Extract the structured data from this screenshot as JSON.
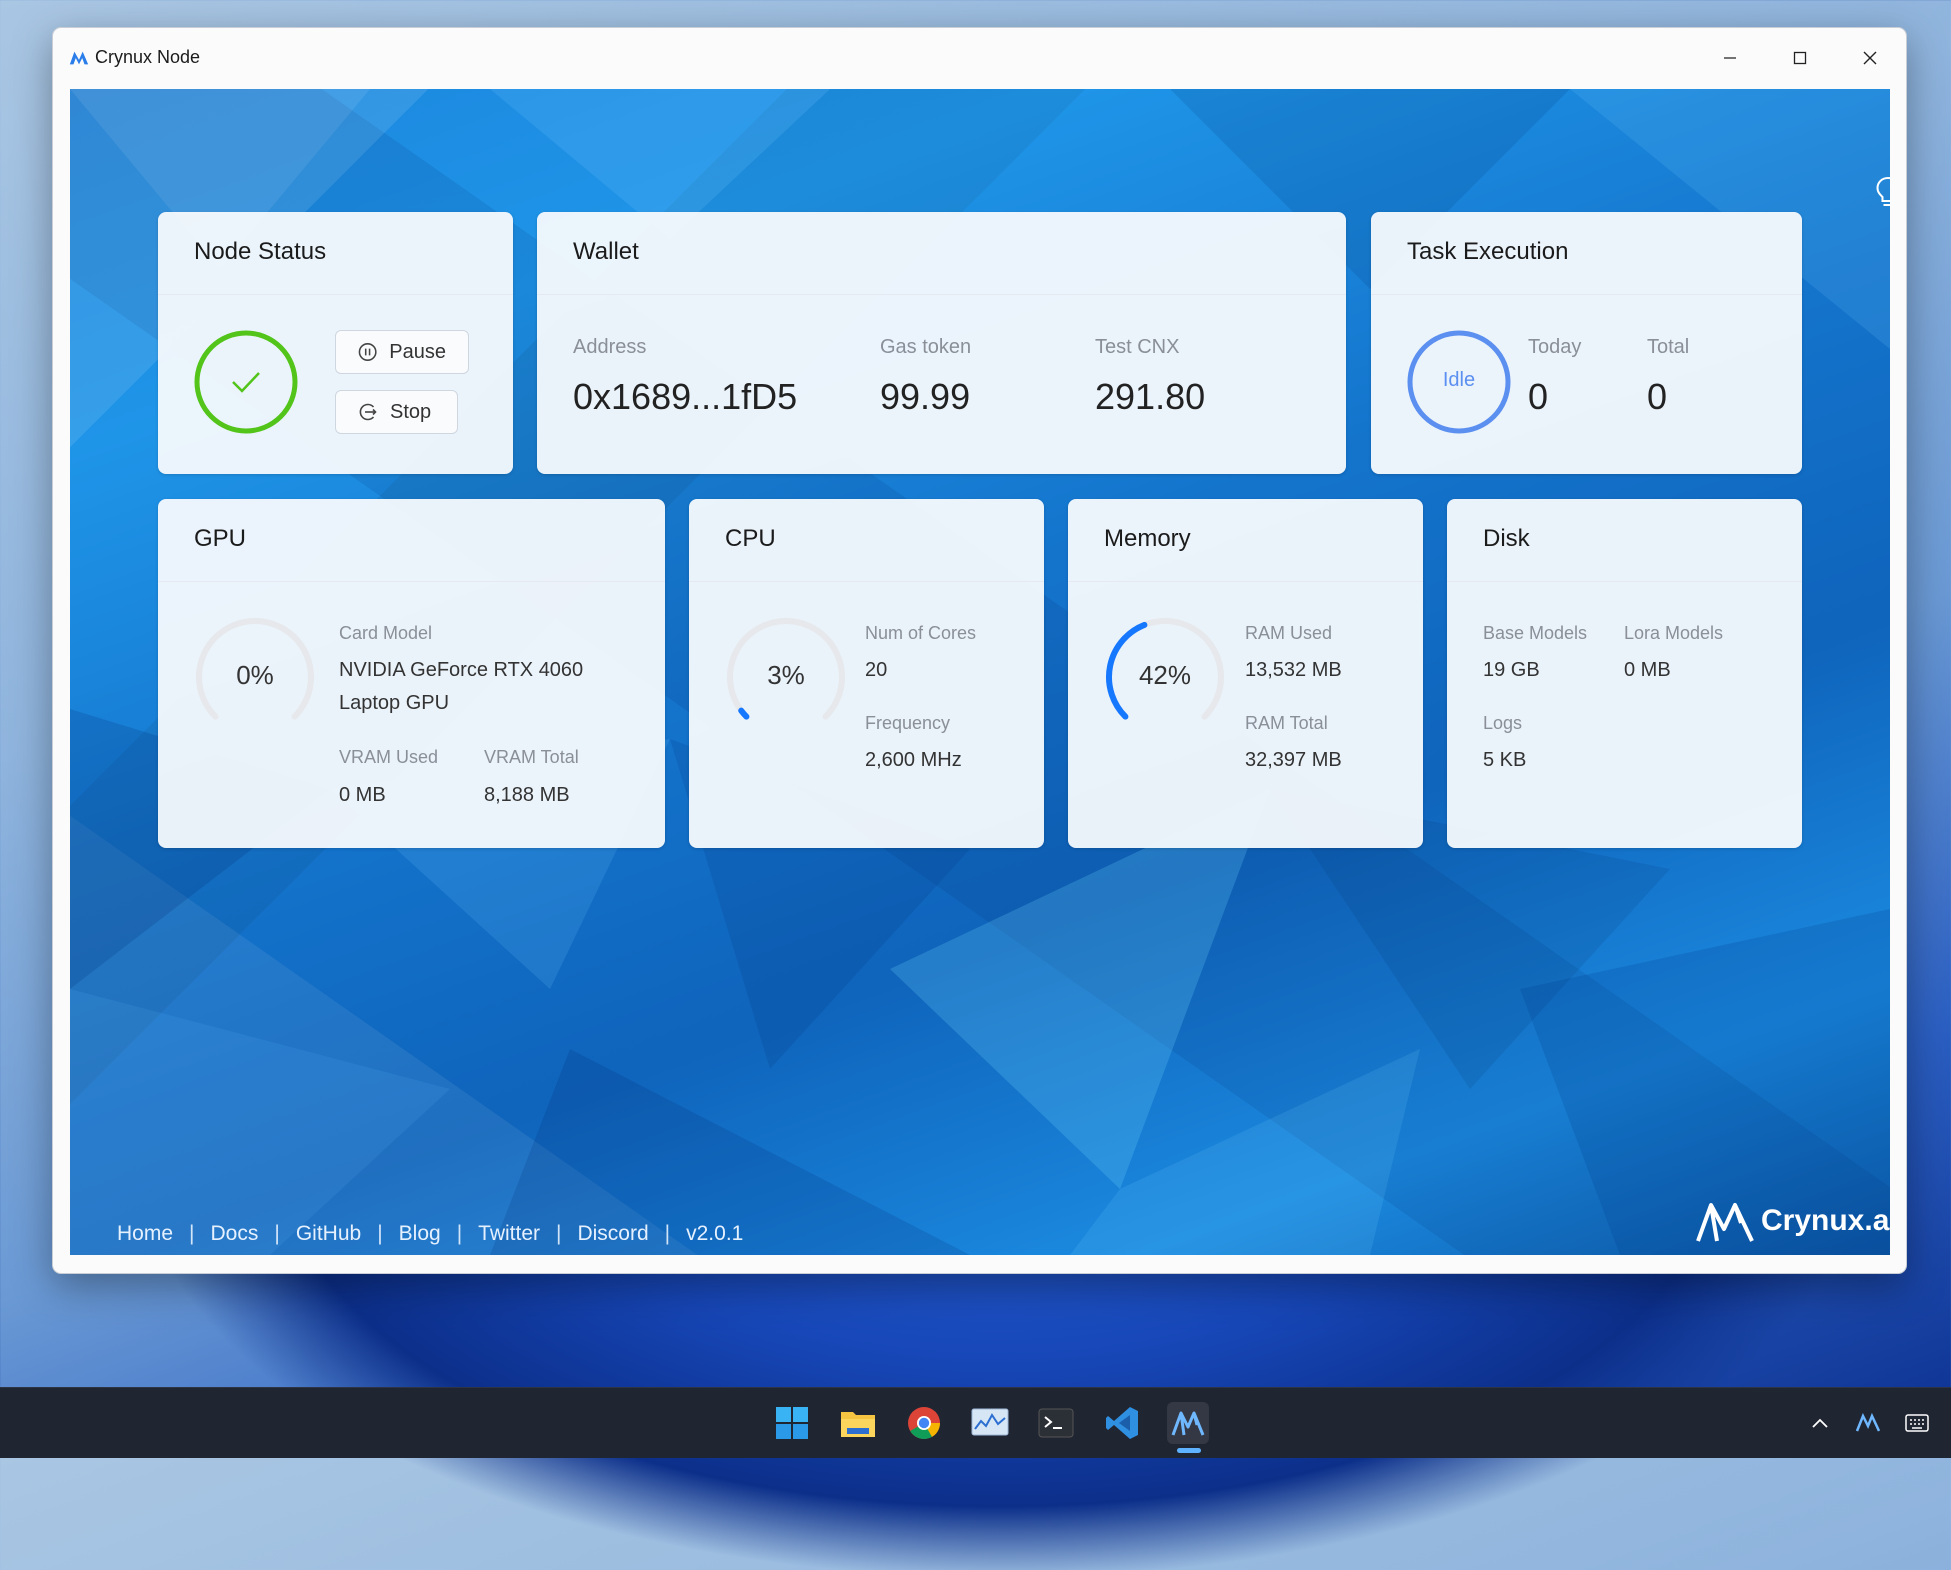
{
  "window": {
    "title": "Crynux Node"
  },
  "node_status": {
    "title": "Node Status",
    "state": "running",
    "pause_label": "Pause",
    "stop_label": "Stop"
  },
  "wallet": {
    "title": "Wallet",
    "address_label": "Address",
    "address_value": "0x1689...1fD5",
    "gas_label": "Gas token",
    "gas_value": "99.99",
    "cnx_label": "Test CNX",
    "cnx_value": "291.80"
  },
  "task_execution": {
    "title": "Task Execution",
    "state": "Idle",
    "today_label": "Today",
    "today_value": "0",
    "total_label": "Total",
    "total_value": "0"
  },
  "gpu": {
    "title": "GPU",
    "usage_text": "0%",
    "usage_fraction": 0.0,
    "card_model_label": "Card Model",
    "card_model_value_line1": "NVIDIA GeForce RTX 4060",
    "card_model_value_line2": "Laptop GPU",
    "vram_used_label": "VRAM Used",
    "vram_used_value": "0 MB",
    "vram_total_label": "VRAM Total",
    "vram_total_value": "8,188 MB"
  },
  "cpu": {
    "title": "CPU",
    "usage_text": "3%",
    "usage_fraction": 0.03,
    "cores_label": "Num of Cores",
    "cores_value": "20",
    "freq_label": "Frequency",
    "freq_value": "2,600 MHz"
  },
  "memory": {
    "title": "Memory",
    "usage_text": "42%",
    "usage_fraction": 0.42,
    "ram_used_label": "RAM Used",
    "ram_used_value": "13,532 MB",
    "ram_total_label": "RAM Total",
    "ram_total_value": "32,397 MB"
  },
  "disk": {
    "title": "Disk",
    "base_models_label": "Base Models",
    "base_models_value": "19 GB",
    "lora_models_label": "Lora Models",
    "lora_models_value": "0 MB",
    "logs_label": "Logs",
    "logs_value": "5 KB"
  },
  "footer": {
    "links": [
      "Home",
      "Docs",
      "GitHub",
      "Blog",
      "Twitter",
      "Discord"
    ],
    "version": "v2.0.1",
    "separator": "|",
    "brand": "Crynux.ai"
  },
  "taskbar": {
    "icons": [
      "windows-start-icon",
      "file-explorer-icon",
      "chrome-icon",
      "resource-monitor-icon",
      "terminal-icon",
      "vscode-icon",
      "crynux-icon"
    ],
    "tray_icons": [
      "chevron-up-icon",
      "crynux-tray-icon",
      "keyboard-icon"
    ]
  },
  "colors": {
    "gauge_active": "#1677ff",
    "gauge_track": "#e6e8eb",
    "status_green": "#52c41a",
    "idle_blue": "#5b8ff0"
  }
}
